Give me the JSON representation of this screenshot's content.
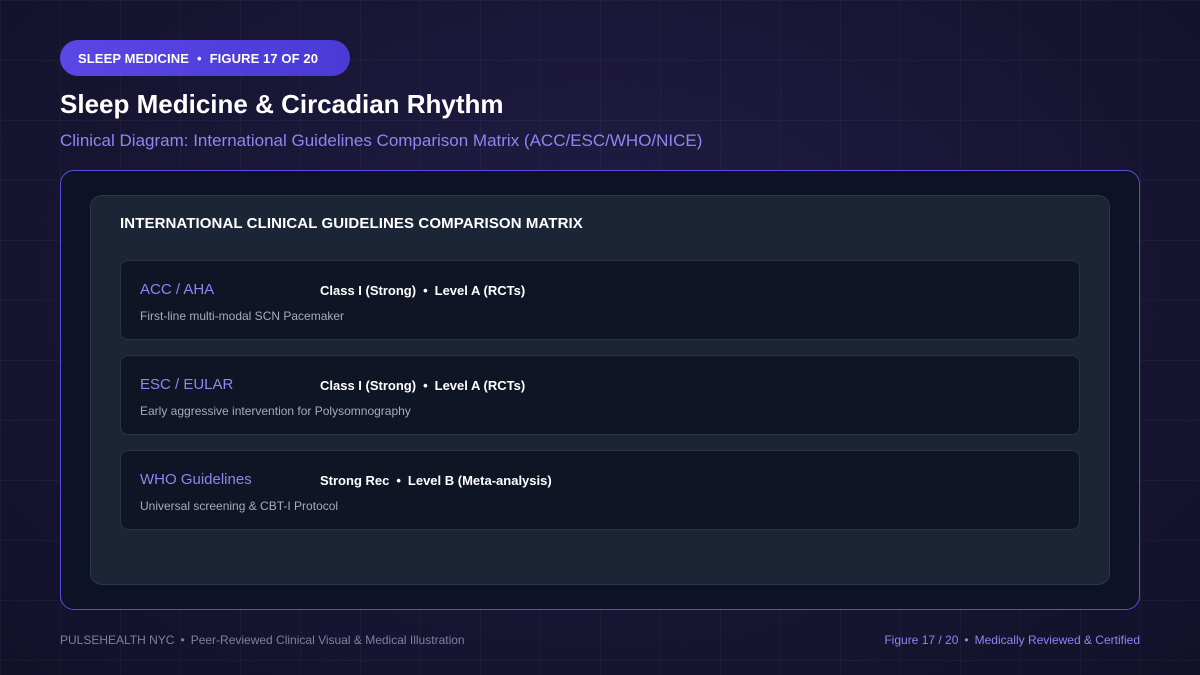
{
  "badge": {
    "section": "SLEEP MEDICINE",
    "figure": "FIGURE 17 OF 20"
  },
  "header": {
    "title": "Sleep Medicine & Circadian Rhythm",
    "subtitle": "Clinical Diagram: International Guidelines Comparison Matrix (ACC/ESC/WHO/NICE)"
  },
  "matrix": {
    "title": "INTERNATIONAL CLINICAL GUIDELINES COMPARISON MATRIX",
    "rows": [
      {
        "org": "ACC / AHA",
        "strength": "Class I (Strong)",
        "level": "Level A (RCTs)",
        "description": "First-line multi-modal SCN Pacemaker"
      },
      {
        "org": "ESC / EULAR",
        "strength": "Class I (Strong)",
        "level": "Level A (RCTs)",
        "description": "Early aggressive intervention for Polysomnography"
      },
      {
        "org": "WHO Guidelines",
        "strength": "Strong Rec",
        "level": "Level B (Meta-analysis)",
        "description": "Universal screening & CBT-I Protocol"
      }
    ]
  },
  "footer": {
    "brand": "PULSEHEALTH NYC",
    "tagline": "Peer-Reviewed Clinical Visual & Medical Illustration",
    "figure": "Figure 17 / 20",
    "certification": "Medically Reviewed & Certified"
  },
  "separator": "•",
  "colors": {
    "accent": "#8e86f2",
    "badge": "#5b46e6",
    "frame_border": "#5a4be0",
    "background": "#191736"
  }
}
